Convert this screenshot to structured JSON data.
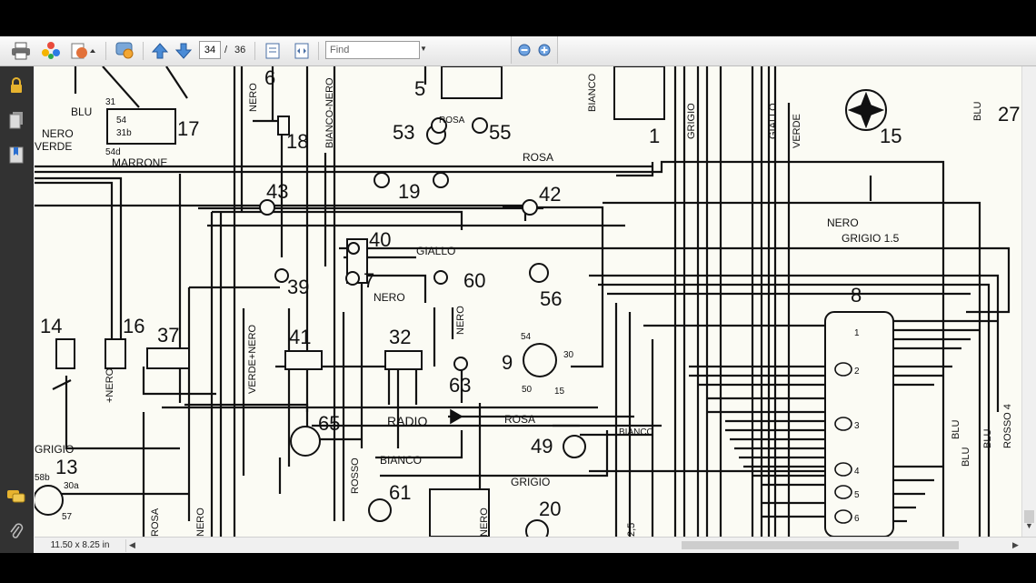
{
  "toolbar": {
    "page_current": "34",
    "page_separator": "/",
    "page_total": "36",
    "find_placeholder": "Find",
    "icons": [
      "print-icon",
      "color-icon",
      "export-icon",
      "comment-icon",
      "page-up-icon",
      "page-down-icon",
      "fit-page-icon",
      "fit-width-icon",
      "zoom-out-icon",
      "zoom-in-icon"
    ]
  },
  "sidebar": {
    "icons": [
      "lock-icon",
      "pages-icon",
      "bookmarks-icon",
      "comments-icon",
      "attachments-icon"
    ]
  },
  "status": {
    "page_size": "11.50 x 8.25 in"
  },
  "diagram": {
    "component_numbers": [
      "6",
      "5",
      "53",
      "55",
      "1",
      "15",
      "27",
      "17",
      "18",
      "43",
      "19",
      "42",
      "40",
      "39",
      "7",
      "60",
      "56",
      "8",
      "14",
      "16",
      "37",
      "41",
      "32",
      "9",
      "63",
      "65",
      "49",
      "13",
      "61",
      "20",
      "54",
      "30",
      "50",
      "15"
    ],
    "wire_labels": [
      "BLU",
      "NERO",
      "VERDE",
      "MARRONE",
      "ROSA",
      "GIALLO",
      "NERO",
      "GRIGIO 1.5",
      "BIANCO",
      "VERDE+NERO",
      "NERO",
      "RADIO",
      "ROSA",
      "BIANCO",
      "GRIGIO",
      "ROSSO",
      "BIANCO-NERO",
      "NERO",
      "BIANCO",
      "GIALLO",
      "VERDE",
      "BLU",
      "NERO",
      "BLU",
      "BLU",
      "ROSSO 4",
      "GRIGIO",
      "+NERO",
      "ROSA",
      "NERO",
      "2,5",
      "GRIGIO"
    ],
    "terminal_labels": [
      "31",
      "54",
      "31b",
      "54d",
      "30",
      "54",
      "50",
      "15",
      "58b",
      "30a",
      "57",
      "1",
      "2",
      "3",
      "4",
      "5",
      "6"
    ]
  }
}
